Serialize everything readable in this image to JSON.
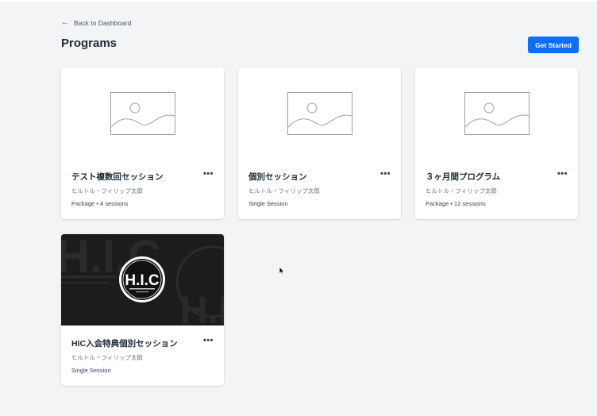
{
  "nav": {
    "back_label": "Back to Dashboard"
  },
  "header": {
    "title": "Programs",
    "cta_label": "Get Started"
  },
  "colors": {
    "accent": "#0d6efd",
    "background": "#f3f4f6",
    "card": "#ffffff"
  },
  "cards": [
    {
      "title": "テスト複数回セッション",
      "author": "ヒルトル・フィリップ太郎",
      "meta": "Package • 4 sessions",
      "more": "•••",
      "thumbnail": "image-placeholder-icon"
    },
    {
      "title": "個別セッション",
      "author": "ヒルトル・フィリップ太郎",
      "meta": "Single Session",
      "more": "•••",
      "thumbnail": "image-placeholder-icon"
    },
    {
      "title": "３ヶ月間プログラム",
      "author": "ヒルトル・フィリップ太郎",
      "meta": "Package • 12 sessions",
      "more": "•••",
      "thumbnail": "image-placeholder-icon"
    },
    {
      "title": "HIC入会特典個別セッション",
      "author": "ヒルトル・フィリップ太郎",
      "meta": "Single Session",
      "more": "•••",
      "thumbnail": "hic-logo",
      "logo_text": "H.I.C"
    }
  ]
}
